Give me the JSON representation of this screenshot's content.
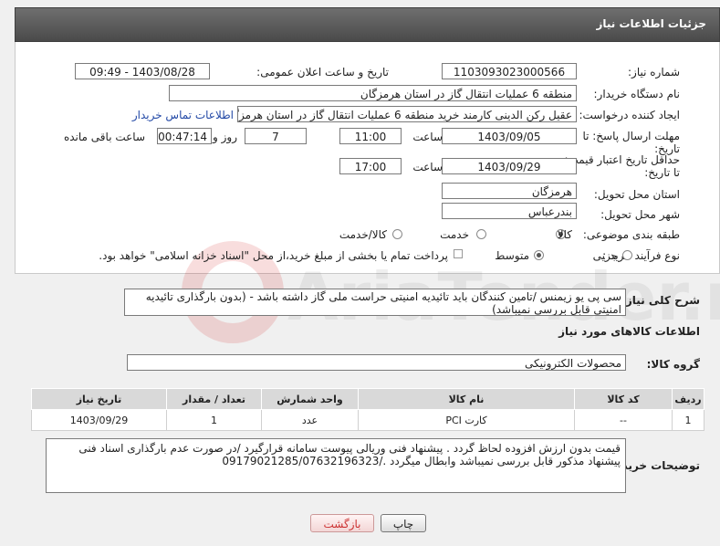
{
  "header": {
    "title": "جزئیات اطلاعات نیاز"
  },
  "form": {
    "need_number_label": "شماره نیاز:",
    "need_number": "1103093023000566",
    "announce_label": "تاریخ و ساعت اعلان عمومی:",
    "announce_value": "1403/08/28 - 09:49",
    "buyer_org_label": "نام دستگاه خریدار:",
    "buyer_org": "منطقه 6 عملیات انتقال گاز در استان هرمزگان",
    "creator_label": "ایجاد کننده درخواست:",
    "creator": "عقیل رکن الدینی کارمند خرید منطقه 6 عملیات انتقال گاز در استان هرمزگان",
    "contact_link": "اطلاعات تماس خریدار",
    "deadline_label": "مهلت ارسال پاسخ: تا تاریخ:",
    "deadline_date": "1403/09/05",
    "time_label": "ساعت",
    "deadline_time": "11:00",
    "days_value": "7",
    "days_label": "روز و",
    "remaining_time": "00:47:14",
    "remaining_label": "ساعت باقی مانده",
    "validity_label": "حداقل تاریخ اعتبار قیمت: تا تاریخ:",
    "validity_date": "1403/09/29",
    "validity_time": "17:00",
    "province_label": "استان محل تحویل:",
    "province": "هرمزگان",
    "city_label": "شهر محل تحویل:",
    "city": "بندرعباس",
    "category_label": "طبقه بندی موضوعی:",
    "category_options": [
      "کالا",
      "خدمت",
      "کالا/خدمت"
    ],
    "process_label": "نوع فرآیند خرید :",
    "process_options": [
      "جزیی",
      "متوسط"
    ],
    "payment_note": "پرداخت تمام یا بخشی از مبلغ خرید،از محل \"اسناد خزانه اسلامی\" خواهد بود."
  },
  "description": {
    "label": "شرح کلی نیاز:",
    "text": "سی پی یو زیمنس /تامین کنندگان باید تائیدیه امنیتی حراست ملی گاز داشته باشد - (بدون بارگذاری تائیدیه امنیتی قابل بررسی نمیباشد)"
  },
  "goods": {
    "section_title": "اطلاعات کالاهای مورد نیاز",
    "group_label": "گروه کالا:",
    "group_value": "محصولات الکترونیکی",
    "columns": [
      "ردیف",
      "کد کالا",
      "نام کالا",
      "واحد شمارش",
      "تعداد / مقدار",
      "تاریخ نیاز"
    ],
    "rows": [
      [
        "1",
        "--",
        "کارت PCI",
        "عدد",
        "1",
        "1403/09/29"
      ]
    ]
  },
  "buyer_notes": {
    "label": "توضیحات خریدار:",
    "text": "قیمت بدون ارزش افزوده لحاظ گردد . پیشنهاد فنی وریالی پیوست سامانه قرارگیرد /در صورت عدم بارگذاری اسناد فنی پیشنهاد مذکور قابل بررسی نمیباشد وابطال میگردد ./09179021285/07632196323"
  },
  "buttons": {
    "print": "چاپ",
    "back": "بازگشت"
  },
  "watermark": {
    "text": "AriaTender.neT"
  }
}
